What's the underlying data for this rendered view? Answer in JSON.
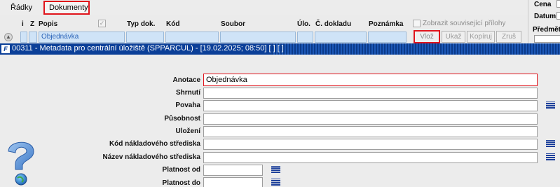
{
  "tabs": {
    "radky": "Řádky",
    "dokumenty": "Dokumenty"
  },
  "right_pane": {
    "cena": "Cena",
    "datum": "Datum",
    "predmet": "Předmět"
  },
  "grid": {
    "headers": {
      "i": "i",
      "z": "Z",
      "popis": "Popis",
      "typ_dok": "Typ dok.",
      "kod": "Kód",
      "soubor": "Soubor",
      "ulo": "Úlo.",
      "c_dokladu": "Č. dokladu",
      "poznamka": "Poznámka"
    },
    "check_mark": "✓",
    "show_related_label": "Zobrazit související přílohy",
    "row": {
      "popis": "Objednávka"
    },
    "buttons": {
      "vloz": "Vlož",
      "ukaz": "Ukaž",
      "kopiruj": "Kopíruj",
      "zrus": "Zruš"
    }
  },
  "window": {
    "title": "00311 - Metadata pro centrální úložiště (SPPARCUL) - [19.02.2025; 08:50]  [ ]  [ ]"
  },
  "form": {
    "anotace": {
      "label": "Anotace",
      "value": "Objednávka"
    },
    "shrnuti": {
      "label": "Shrnutí",
      "value": ""
    },
    "povaha": {
      "label": "Povaha",
      "value": ""
    },
    "pusobnost": {
      "label": "Působnost",
      "value": ""
    },
    "ulozeni": {
      "label": "Uložení",
      "value": ""
    },
    "kod_strediska": {
      "label": "Kód nákladového střediska",
      "value": ""
    },
    "nazev_strediska": {
      "label": "Název nákladového střediska",
      "value": ""
    },
    "platnost_od": {
      "label": "Platnost od",
      "value": ""
    },
    "platnost_do": {
      "label": "Platnost do",
      "value": ""
    }
  },
  "colors": {
    "highlight_red": "#e0141c",
    "title_bar_blue": "#0b3f98",
    "row_selected": "#cfe3f7",
    "row_text": "#2a63b8"
  },
  "icons": [
    "row-selector-icon",
    "app-logo-icon",
    "list-picker-icon",
    "help-question-icon"
  ]
}
